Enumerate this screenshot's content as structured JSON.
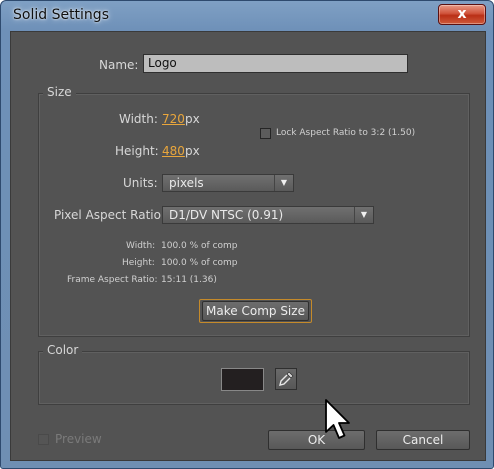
{
  "window": {
    "title": "Solid Settings",
    "close_label": "x"
  },
  "name": {
    "label": "Name:",
    "value": "Logo"
  },
  "size": {
    "group_title": "Size",
    "width_label": "Width:",
    "width_value": "720",
    "width_unit": "px",
    "height_label": "Height:",
    "height_value": "480",
    "height_unit": "px",
    "lock_label": "Lock Aspect Ratio to 3:2 (1.50)",
    "lock_checked": false,
    "units_label": "Units:",
    "units_value": "pixels",
    "par_label": "Pixel Aspect Ratio:",
    "par_value": "D1/DV NTSC (0.91)",
    "info": {
      "width_label": "Width:",
      "width_value": "100.0 % of comp",
      "height_label": "Height:",
      "height_value": "100.0 % of comp",
      "far_label": "Frame Aspect Ratio:",
      "far_value": "15:11 (1.36)"
    },
    "make_comp_label": "Make Comp Size"
  },
  "color": {
    "group_title": "Color",
    "swatch_hex": "#231f20"
  },
  "footer": {
    "preview_label": "Preview",
    "ok_label": "OK",
    "cancel_label": "Cancel"
  },
  "colors": {
    "accent_orange": "#e9a63c",
    "dialog_bg": "#535353",
    "title_bar": "#6e90b8"
  },
  "icons": [
    "close-icon",
    "checkbox-icon",
    "dropdown-arrow-icon",
    "eyedropper-icon",
    "mouse-cursor-icon"
  ]
}
